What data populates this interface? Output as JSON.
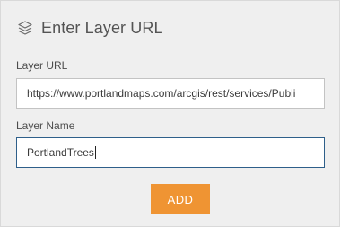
{
  "header": {
    "icon": "layers-icon",
    "title": "Enter Layer URL"
  },
  "form": {
    "url_label": "Layer URL",
    "url_value": "https://www.portlandmaps.com/arcgis/rest/services/Publi",
    "name_label": "Layer Name",
    "name_value": "PortlandTrees"
  },
  "actions": {
    "add_label": "ADD"
  },
  "colors": {
    "accent": "#ef9433",
    "focus_border": "#2e5f8a",
    "panel_bg": "#efefef"
  }
}
